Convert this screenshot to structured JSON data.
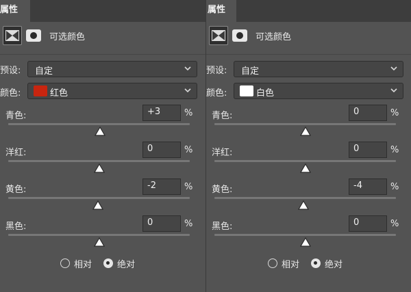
{
  "panels": [
    {
      "tab": "属性",
      "title": "可选颜色",
      "preset_label": "预设:",
      "preset_value": "自定",
      "colors_label": "颜色:",
      "color_value": "红色",
      "color_swatch": "#c8250f",
      "sliders": [
        {
          "label": "青色:",
          "value": "+3",
          "unit": "%",
          "level": 3
        },
        {
          "label": "洋红:",
          "value": "0",
          "unit": "%",
          "level": 0
        },
        {
          "label": "黄色:",
          "value": "-2",
          "unit": "%",
          "level": -2
        },
        {
          "label": "黑色:",
          "value": "0",
          "unit": "%",
          "level": 0
        }
      ],
      "method_relative": "相对",
      "method_absolute": "绝对",
      "method_selected": "绝对"
    },
    {
      "tab": "属性",
      "title": "可选颜色",
      "preset_label": "预设:",
      "preset_value": "自定",
      "colors_label": "颜色:",
      "color_value": "白色",
      "color_swatch": "#ffffff",
      "sliders": [
        {
          "label": "青色:",
          "value": "0",
          "unit": "%",
          "level": 0
        },
        {
          "label": "洋红:",
          "value": "0",
          "unit": "%",
          "level": 0
        },
        {
          "label": "黄色:",
          "value": "-4",
          "unit": "%",
          "level": -4
        },
        {
          "label": "黑色:",
          "value": "0",
          "unit": "%",
          "level": 0
        }
      ],
      "method_relative": "相对",
      "method_absolute": "绝对",
      "method_selected": "绝对"
    }
  ],
  "theme": {
    "panel_bg": "#535353",
    "tabbar_bg": "#3d3d3d",
    "field_bg": "#454545",
    "text": "#e8e8e8"
  },
  "icons": {
    "adjustment": "selective-color-icon",
    "mask": "layer-mask-icon",
    "dropdown": "chevron-down-icon",
    "slider_thumb": "triangle-thumb-icon"
  }
}
